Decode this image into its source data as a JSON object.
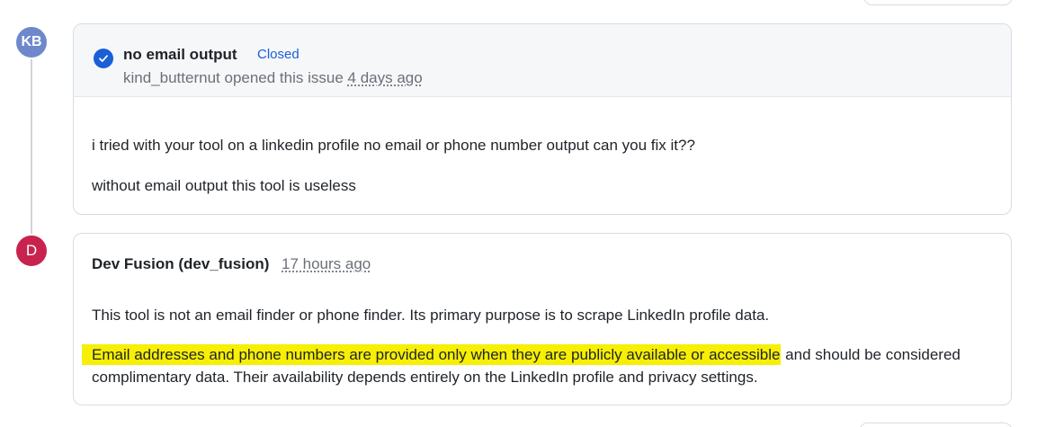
{
  "issue": {
    "avatar_initials": "KB",
    "title": "no email output",
    "status": "Closed",
    "author": "kind_butternut",
    "opened_text": "opened this issue",
    "time": "4 days ago",
    "body": [
      "i tried with your tool on a linkedin profile no email or phone number output can you fix it??",
      "without email output this tool is useless"
    ]
  },
  "comment": {
    "avatar_initials": "D",
    "author": "Dev Fusion (dev_fusion)",
    "time": "17 hours ago",
    "paragraph1": "This tool is not an email finder or phone finder. Its primary purpose is to scrape LinkedIn profile data.",
    "paragraph2_highlight": "Email addresses and phone numbers are provided only when they are publicly available or accessible",
    "paragraph2_rest": " and should be considered complimentary data. Their availability depends entirely on the LinkedIn profile and privacy settings."
  },
  "colors": {
    "status_closed": "#1a5fd6",
    "avatar_kb": "#6f88cc",
    "avatar_d": "#c8234f",
    "highlight": "#f7ef04"
  },
  "icons": {
    "status": "check-circle-icon"
  }
}
